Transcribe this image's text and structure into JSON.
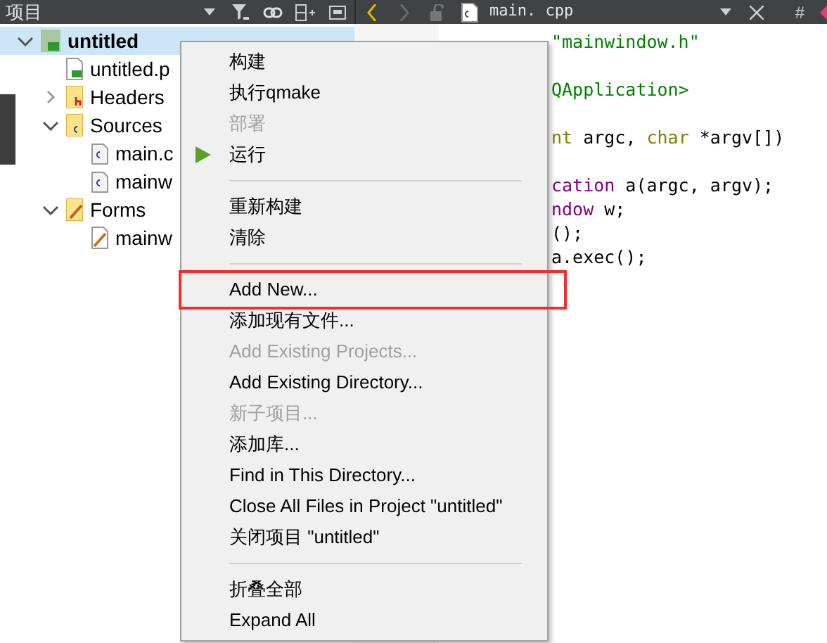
{
  "projects_panel": {
    "title": "项目"
  },
  "editor_tab": {
    "filename": "main. cpp",
    "extra": "#"
  },
  "tree": [
    {
      "label": "untitled",
      "kind": "project",
      "selected": true,
      "expanded": true,
      "children": [
        {
          "label": "untitled.p",
          "kind": "pro",
          "selected": false
        },
        {
          "label": "Headers",
          "kind": "headers",
          "selected": false,
          "expanded": false
        },
        {
          "label": "Sources",
          "kind": "sources",
          "selected": false,
          "expanded": true,
          "children": [
            {
              "label": "main.c",
              "kind": "cpp",
              "selected": false
            },
            {
              "label": "mainw",
              "kind": "cpp",
              "selected": false
            }
          ]
        },
        {
          "label": "Forms",
          "kind": "forms",
          "selected": false,
          "expanded": true,
          "children": [
            {
              "label": "mainw",
              "kind": "ui",
              "selected": false
            }
          ]
        }
      ]
    }
  ],
  "code_lines": [
    {
      "blank_before": false,
      "segments": [
        {
          "text": "\"mainwindow.h\"",
          "kind": "string"
        }
      ]
    },
    {
      "blank_before": true,
      "segments": [
        {
          "text": "QApplication>",
          "kind": "string"
        }
      ]
    },
    {
      "blank_before": true,
      "segments": [
        {
          "text": "nt",
          "kind": "keyword"
        },
        {
          "text": " argc, ",
          "kind": "plain"
        },
        {
          "text": "char",
          "kind": "keyword"
        },
        {
          "text": " *argv[])",
          "kind": "plain"
        }
      ]
    },
    {
      "blank_before": true,
      "segments": [
        {
          "text": "cation",
          "kind": "type"
        },
        {
          "text": " a(argc, argv);",
          "kind": "plain"
        }
      ]
    },
    {
      "blank_before": false,
      "segments": [
        {
          "text": "ndow",
          "kind": "type"
        },
        {
          "text": " w;",
          "kind": "plain"
        }
      ]
    },
    {
      "blank_before": false,
      "segments": [
        {
          "text": "();",
          "kind": "plain"
        }
      ]
    },
    {
      "blank_before": false,
      "segments": [
        {
          "text": "a.exec();",
          "kind": "plain"
        }
      ]
    }
  ],
  "context_menu": [
    {
      "kind": "item",
      "label": "构建",
      "disabled": false,
      "highlighted": false
    },
    {
      "kind": "item",
      "label": "执行qmake",
      "disabled": false,
      "highlighted": false
    },
    {
      "kind": "item",
      "label": "部署",
      "disabled": true,
      "highlighted": false
    },
    {
      "kind": "run",
      "label": "运行",
      "disabled": false,
      "highlighted": false
    },
    {
      "kind": "separator"
    },
    {
      "kind": "item",
      "label": "重新构建",
      "disabled": false,
      "highlighted": false
    },
    {
      "kind": "item",
      "label": "清除",
      "disabled": false,
      "highlighted": false
    },
    {
      "kind": "separator"
    },
    {
      "kind": "item",
      "label": "Add New...",
      "disabled": false,
      "highlighted": true
    },
    {
      "kind": "item",
      "label": "添加现有文件...",
      "disabled": false,
      "highlighted": false
    },
    {
      "kind": "item",
      "label": "Add Existing Projects...",
      "disabled": true,
      "highlighted": false
    },
    {
      "kind": "item",
      "label": "Add Existing Directory...",
      "disabled": false,
      "highlighted": false
    },
    {
      "kind": "item",
      "label": "新子项目...",
      "disabled": true,
      "highlighted": false
    },
    {
      "kind": "item",
      "label": "添加库...",
      "disabled": false,
      "highlighted": false
    },
    {
      "kind": "item",
      "label": "Find in This Directory...",
      "disabled": false,
      "highlighted": false
    },
    {
      "kind": "item",
      "label": "Close All Files in Project \"untitled\"",
      "disabled": false,
      "highlighted": false
    },
    {
      "kind": "item",
      "label": "关闭项目 \"untitled\"",
      "disabled": false,
      "highlighted": false
    },
    {
      "kind": "separator"
    },
    {
      "kind": "item",
      "label": "折叠全部",
      "disabled": false,
      "highlighted": false
    },
    {
      "kind": "item",
      "label": "Expand All",
      "disabled": false,
      "highlighted": false
    }
  ]
}
